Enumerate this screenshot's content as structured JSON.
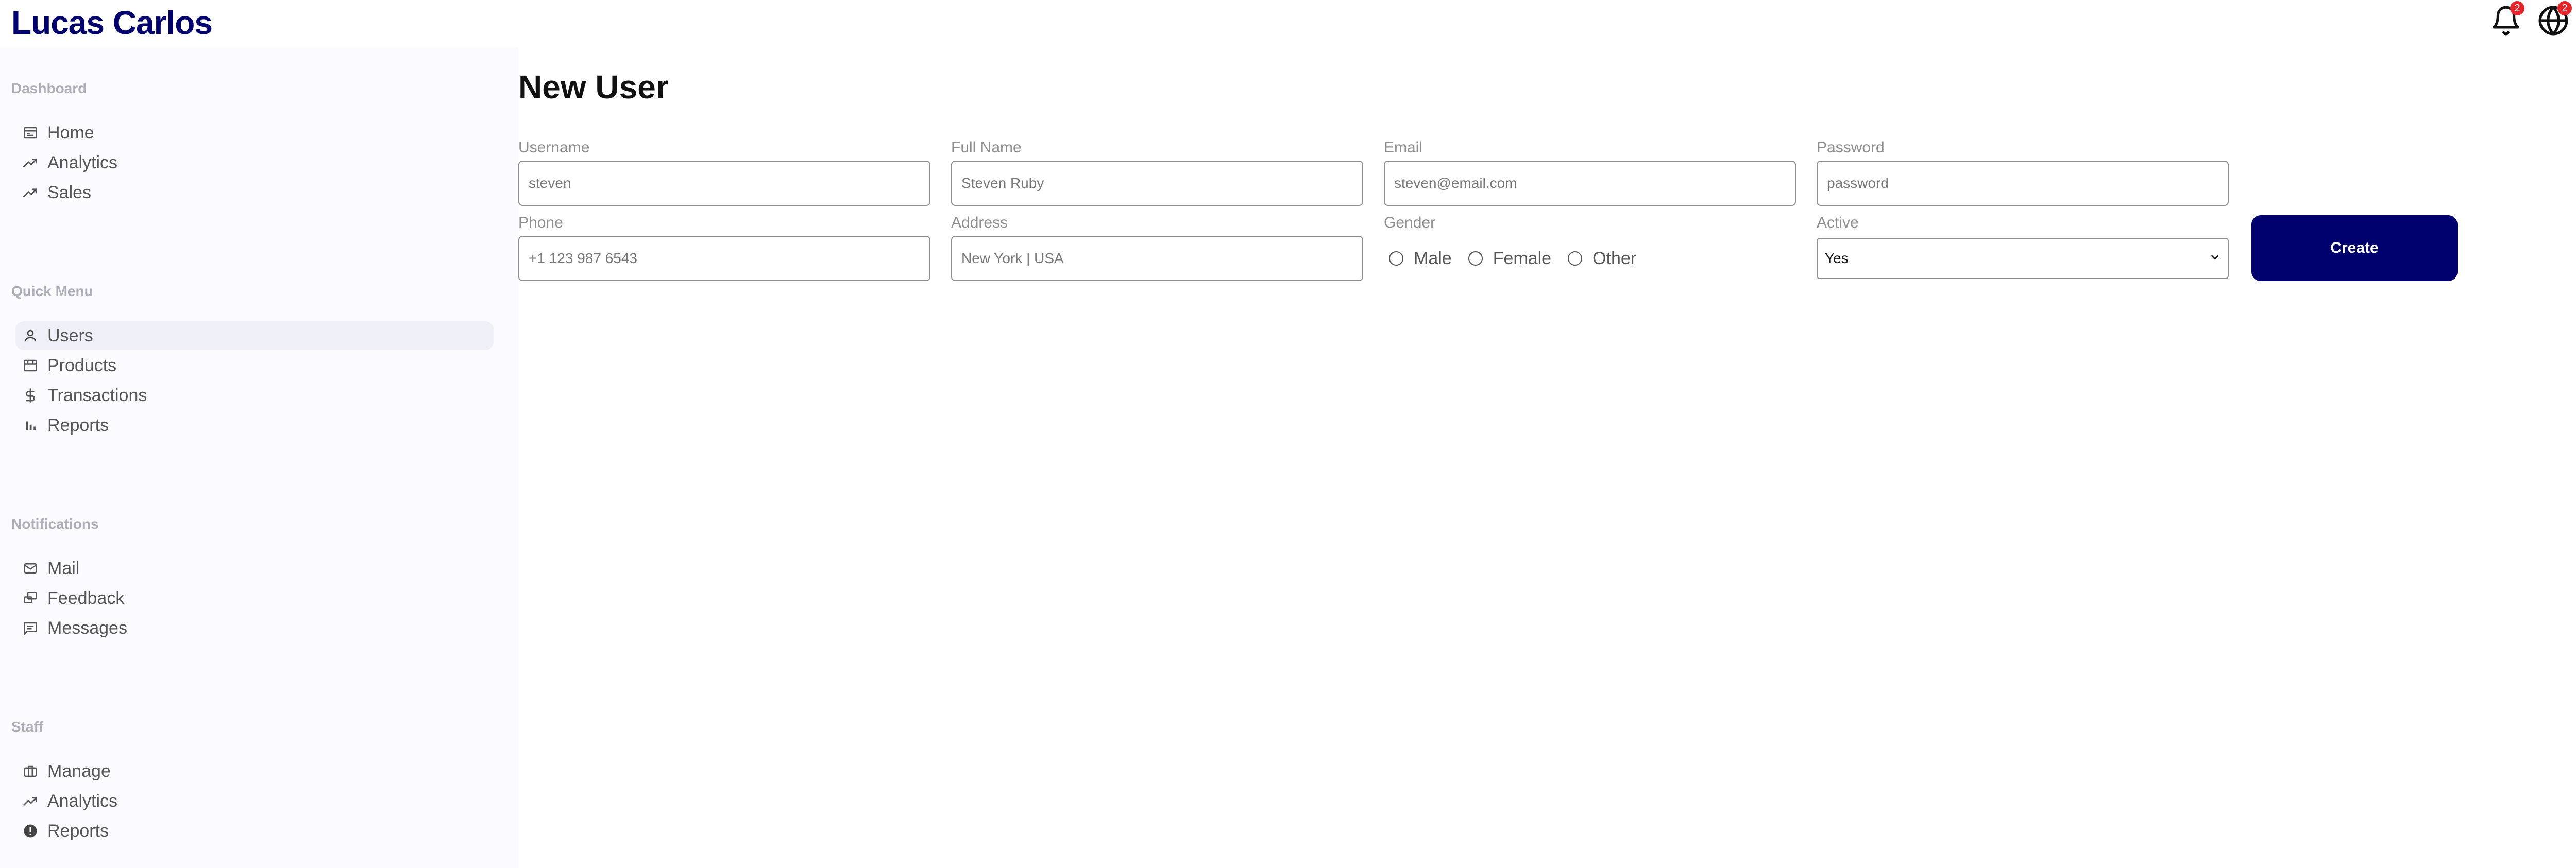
{
  "app": {
    "brand": "Lucas Carlos"
  },
  "topbar": {
    "notifications_badge": "2",
    "language_badge": "2"
  },
  "sidebar": {
    "sections": [
      {
        "title": "Dashboard",
        "items": [
          {
            "label": "Home",
            "icon": "home-icon"
          },
          {
            "label": "Analytics",
            "icon": "trend-icon"
          },
          {
            "label": "Sales",
            "icon": "trend-icon"
          }
        ]
      },
      {
        "title": "Quick Menu",
        "items": [
          {
            "label": "Users",
            "icon": "user-icon",
            "active": true
          },
          {
            "label": "Products",
            "icon": "storefront-icon"
          },
          {
            "label": "Transactions",
            "icon": "dollar-icon"
          },
          {
            "label": "Reports",
            "icon": "bar-chart-icon"
          }
        ]
      },
      {
        "title": "Notifications",
        "items": [
          {
            "label": "Mail",
            "icon": "mail-icon"
          },
          {
            "label": "Feedback",
            "icon": "feedback-icon"
          },
          {
            "label": "Messages",
            "icon": "message-icon"
          }
        ]
      },
      {
        "title": "Staff",
        "items": [
          {
            "label": "Manage",
            "icon": "briefcase-icon"
          },
          {
            "label": "Analytics",
            "icon": "trend-icon"
          },
          {
            "label": "Reports",
            "icon": "report-icon"
          }
        ]
      }
    ]
  },
  "main": {
    "title": "New User",
    "form": {
      "username": {
        "label": "Username",
        "placeholder": "steven"
      },
      "fullname": {
        "label": "Full Name",
        "placeholder": "Steven Ruby"
      },
      "email": {
        "label": "Email",
        "placeholder": "steven@email.com"
      },
      "password": {
        "label": "Password",
        "placeholder": "password"
      },
      "phone": {
        "label": "Phone",
        "placeholder": "+1 123 987 6543"
      },
      "address": {
        "label": "Address",
        "placeholder": "New York | USA"
      },
      "gender": {
        "label": "Gender",
        "options": [
          "Male",
          "Female",
          "Other"
        ]
      },
      "active": {
        "label": "Active",
        "selected": "Yes"
      },
      "submit_label": "Create"
    }
  },
  "colors": {
    "brand": "#00006e",
    "badge": "#e5252a",
    "sidebar_bg": "#fbfbff"
  }
}
